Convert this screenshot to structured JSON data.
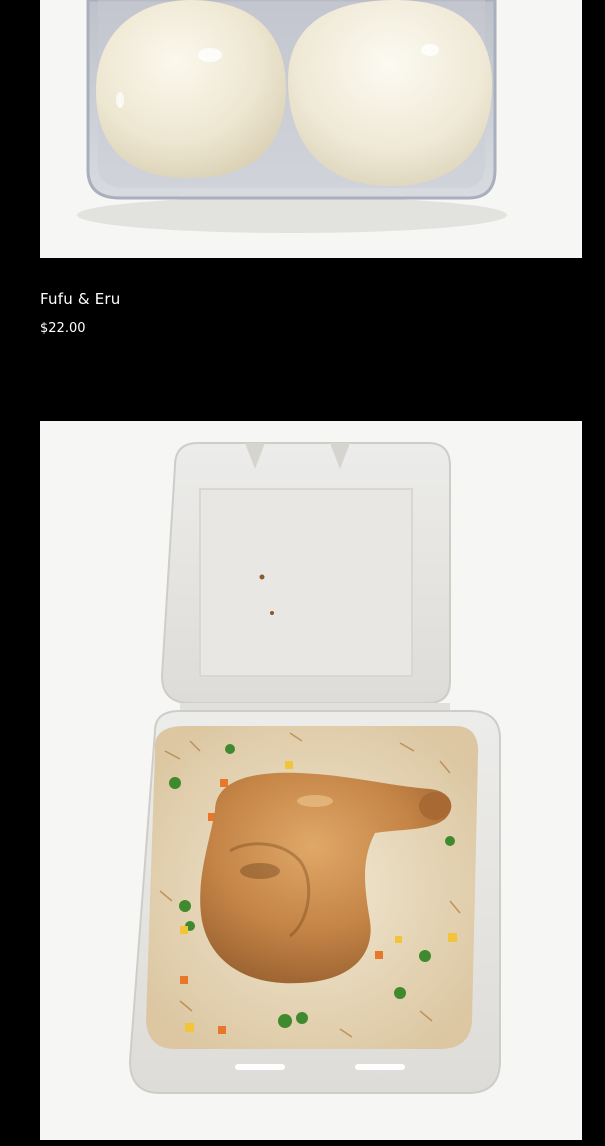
{
  "products": [
    {
      "title": "Fufu & Eru",
      "price": "$22.00",
      "image_icon": "fufu-balls-photo"
    },
    {
      "title": "",
      "price": "",
      "image_icon": "chicken-rice-takeout-photo"
    }
  ],
  "colors": {
    "page_background": "#000000",
    "text": "#ffffff",
    "photo_background": "#f6f6f4"
  }
}
